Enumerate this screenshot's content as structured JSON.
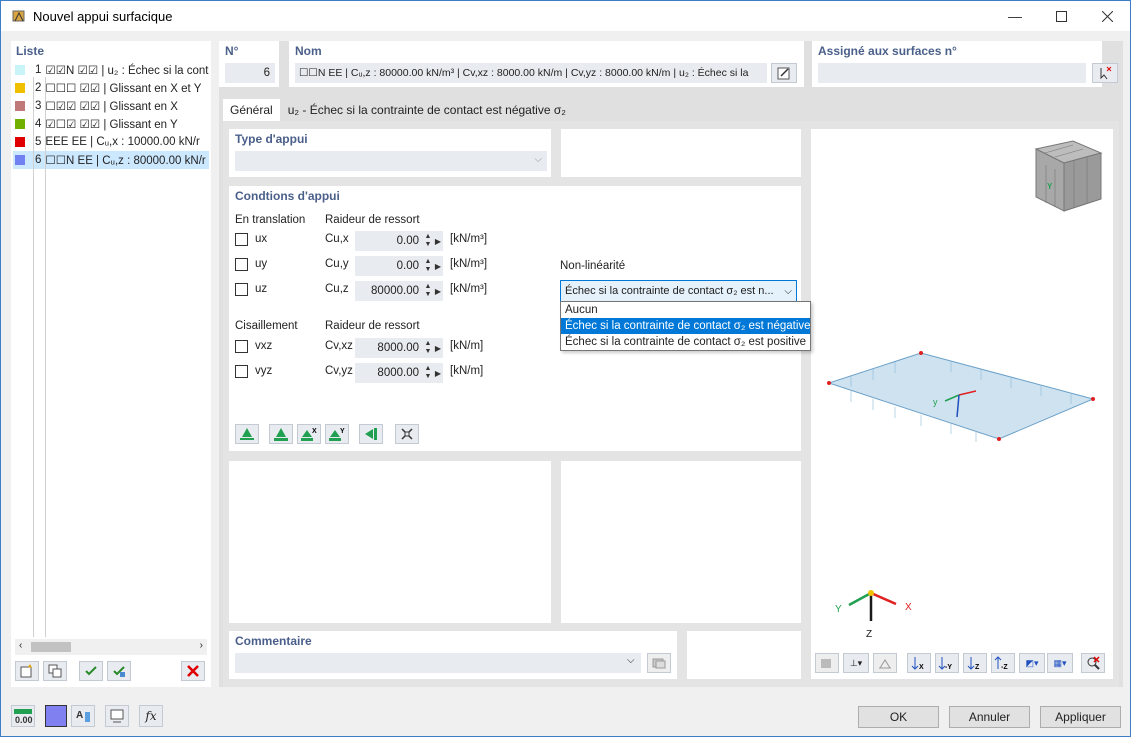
{
  "window": {
    "title": "Nouvel appui surfacique",
    "controls": [
      "minimize-icon",
      "maximize-icon",
      "close-icon"
    ]
  },
  "list": {
    "title": "Liste",
    "items": [
      {
        "num": "1",
        "color": "#c8f4f8",
        "text": "☑☑N ☑☑ | u₂ : Échec si la cont"
      },
      {
        "num": "2",
        "color": "#f0c000",
        "text": "☐☐☐ ☑☑ | Glissant en X et Y"
      },
      {
        "num": "3",
        "color": "#c07878",
        "text": "☐☑☑ ☑☑ | Glissant en X"
      },
      {
        "num": "4",
        "color": "#70b000",
        "text": "☑☐☑ ☑☑ | Glissant en Y"
      },
      {
        "num": "5",
        "color": "#e00000",
        "text": "EEE EE | Cᵤ,x : 10000.00 kN/r"
      },
      {
        "num": "6",
        "color": "#7080f0",
        "text": "☐☐N EE | Cᵤ,z : 80000.00 kN/r"
      }
    ],
    "selected_index": 5
  },
  "number": {
    "label": "N°",
    "value": "6"
  },
  "name": {
    "label": "Nom",
    "value": "☐☐N  EE | Cᵤ,z : 80000.00 kN/m³ | Cv,xz : 8000.00 kN/m | Cv,yz : 8000.00 kN/m | u₂ : Échec si la"
  },
  "assigned": {
    "label": "Assigné aux surfaces n°",
    "value": ""
  },
  "tabs": [
    {
      "label": "Général",
      "active": true
    },
    {
      "label": "u₂ - Échec si la contrainte de contact est négative σ₂",
      "active": false
    }
  ],
  "support_type": {
    "label": "Type d'appui",
    "value": ""
  },
  "conditions": {
    "title": "Condtions d'appui",
    "translation_header": "En translation",
    "stiffness_header": "Raideur de ressort",
    "translation": [
      {
        "dof": "ux",
        "sub": "x",
        "coef": "Cu,x",
        "value": "0.00",
        "unit": "[kN/m³]",
        "checked": false
      },
      {
        "dof": "uy",
        "sub": "y",
        "coef": "Cu,y",
        "value": "0.00",
        "unit": "[kN/m³]",
        "checked": false
      },
      {
        "dof": "uz",
        "sub": "z",
        "coef": "Cu,z",
        "value": "80000.00",
        "unit": "[kN/m³]",
        "checked": false
      }
    ],
    "shear_header": "Cisaillement",
    "shear_stiffness_header": "Raideur de ressort",
    "shear": [
      {
        "dof": "vxz",
        "sub": "xz",
        "coef": "Cv,xz",
        "value": "8000.00",
        "unit": "[kN/m]",
        "checked": false
      },
      {
        "dof": "vyz",
        "sub": "yz",
        "coef": "Cv,yz",
        "value": "8000.00",
        "unit": "[kN/m]",
        "checked": false
      }
    ],
    "nonlinearity_label": "Non-linéarité",
    "nonlinearity_value": "Échec si la contrainte de contact σ₂ est n...",
    "options": [
      "Aucun",
      "Échec si la contrainte de contact σ₂ est négative",
      "Échec si la contrainte de contact σ₂ est positive"
    ],
    "selected_option_index": 1
  },
  "comment": {
    "label": "Commentaire",
    "value": ""
  },
  "axes": {
    "x": "X",
    "y": "Y",
    "z": "Z"
  },
  "cube": {
    "face_y": "Y"
  },
  "buttons": {
    "ok": "OK",
    "cancel": "Annuler",
    "apply": "Appliquer"
  },
  "colors": {
    "accent": "#0078d7",
    "section_title": "#4a5f8a",
    "green_icon": "#20a050"
  }
}
